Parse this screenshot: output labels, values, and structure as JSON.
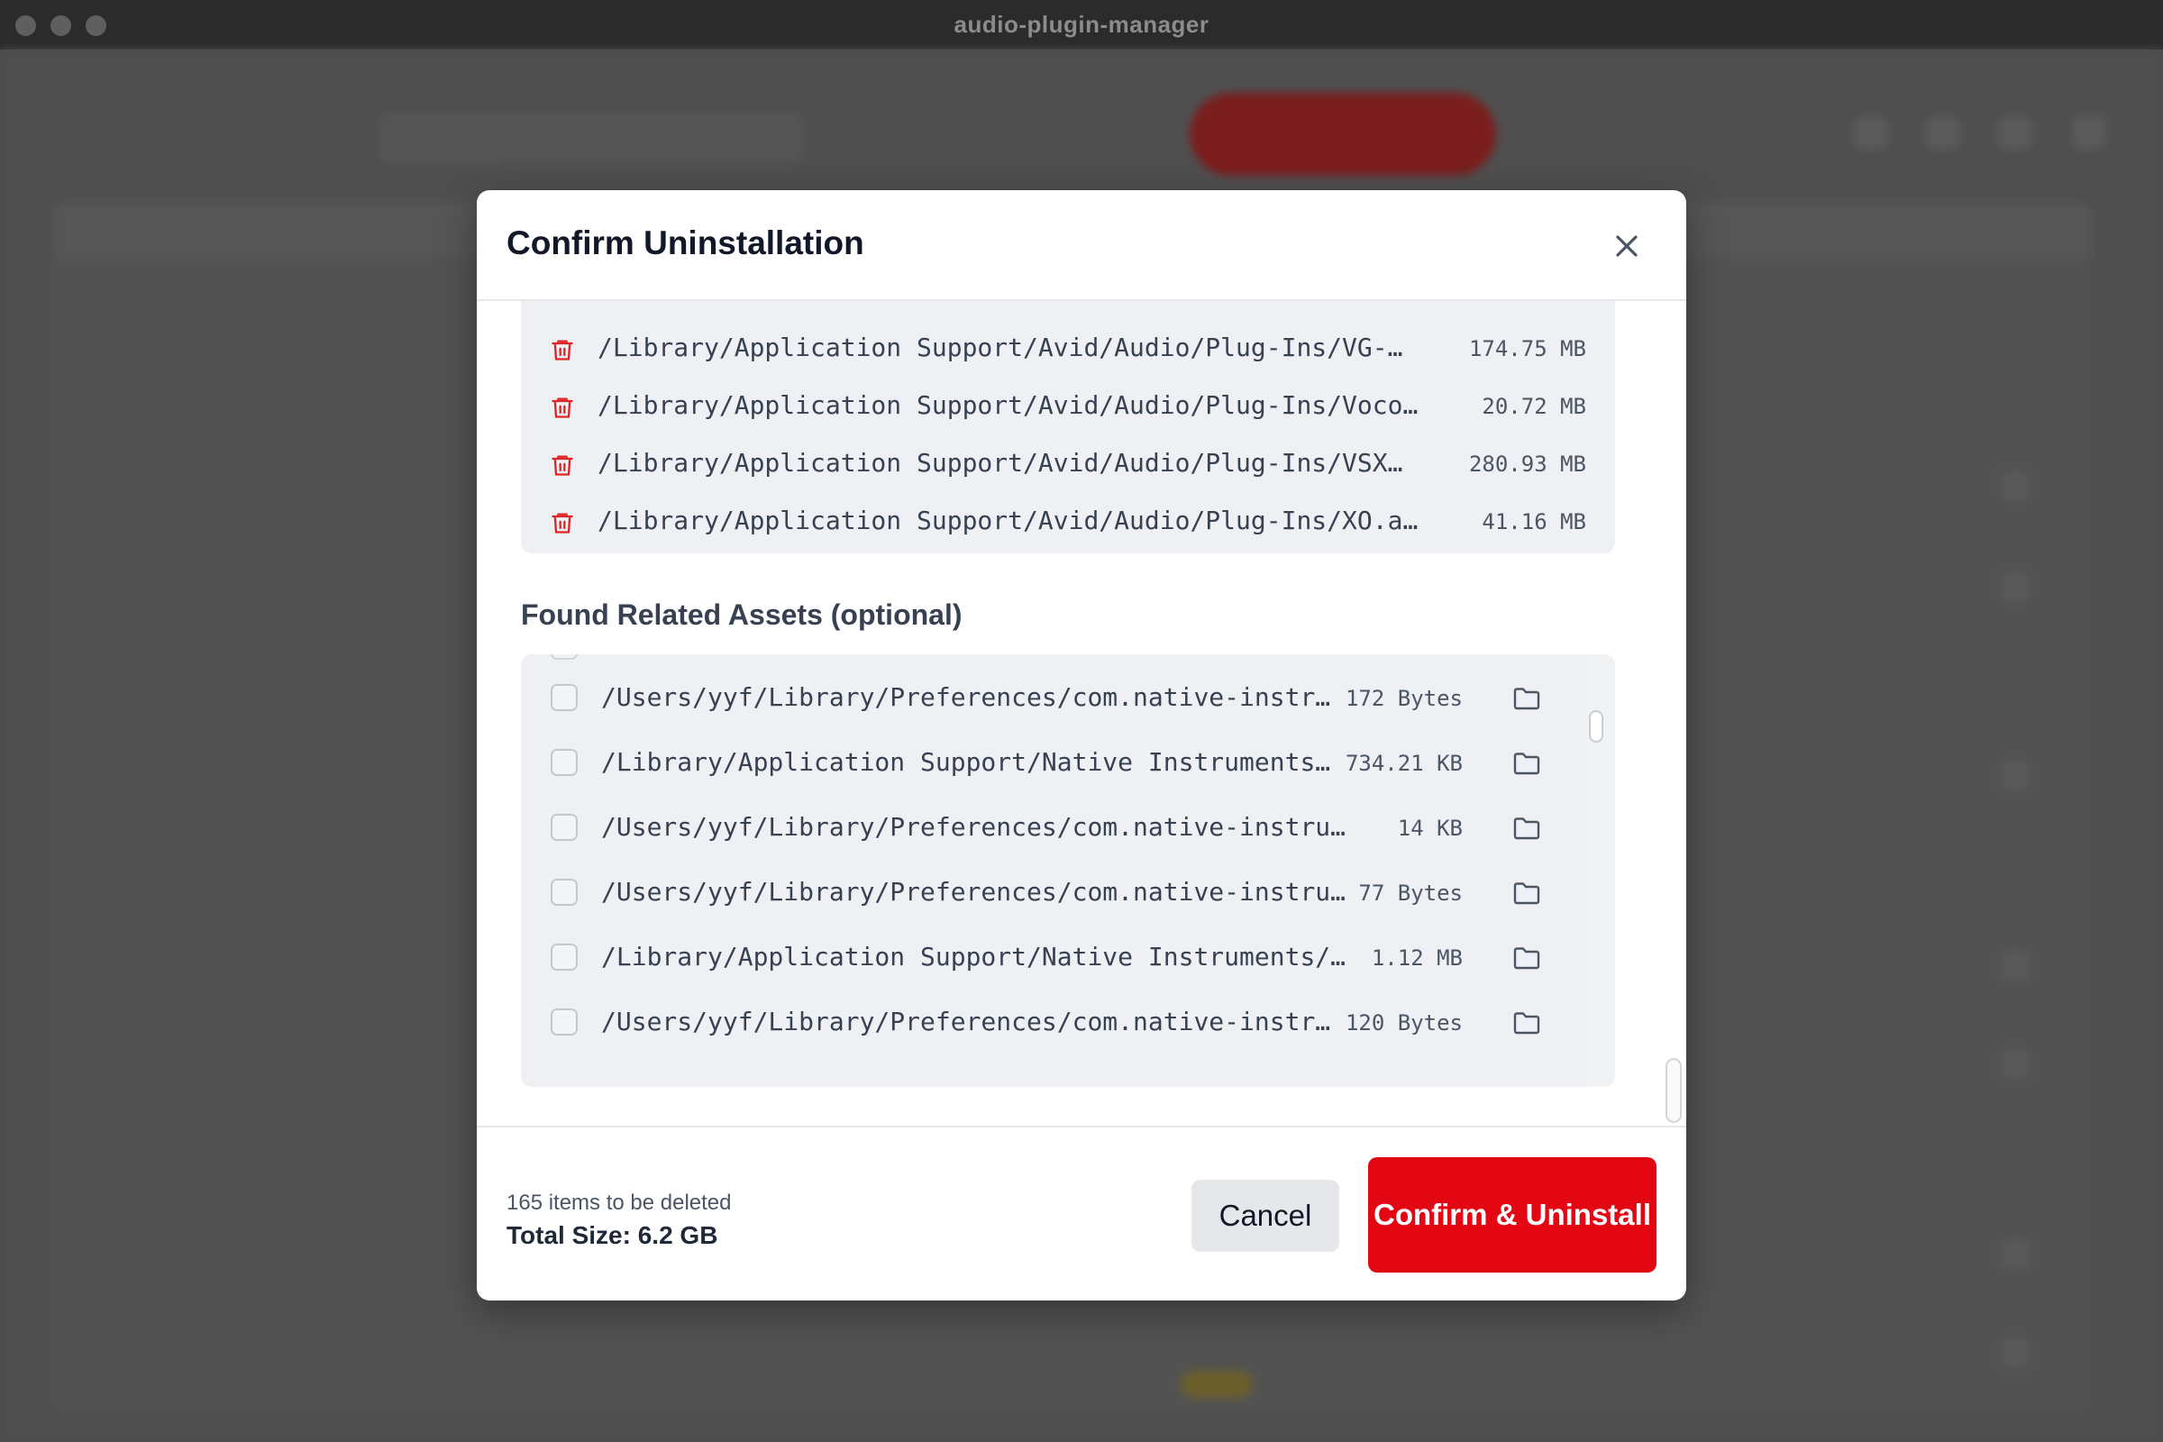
{
  "window": {
    "title": "audio-plugin-manager"
  },
  "modal": {
    "title": "Confirm Uninstallation",
    "files": [
      {
        "path": "/Library/Application Support/Avid/Audio/Plug-Ins/VG-…",
        "size": "174.75 MB"
      },
      {
        "path": "/Library/Application Support/Avid/Audio/Plug-Ins/Voco…",
        "size": "20.72 MB"
      },
      {
        "path": "/Library/Application Support/Avid/Audio/Plug-Ins/VSX…",
        "size": "280.93 MB"
      },
      {
        "path": "/Library/Application Support/Avid/Audio/Plug-Ins/XO.a…",
        "size": "41.16 MB"
      }
    ],
    "related_heading": "Found Related Assets (optional)",
    "assets": [
      {
        "path": "/Users/yyf/Library/Preferences/com.native-instr…",
        "size": "172 Bytes",
        "checked": false
      },
      {
        "path": "/Library/Application Support/Native Instruments…",
        "size": "734.21 KB",
        "checked": false
      },
      {
        "path": "/Users/yyf/Library/Preferences/com.native-instrume…",
        "size": "14 KB",
        "checked": false
      },
      {
        "path": "/Users/yyf/Library/Preferences/com.native-instru…",
        "size": "77 Bytes",
        "checked": false
      },
      {
        "path": "/Library/Application Support/Native Instruments/…",
        "size": "1.12 MB",
        "checked": false
      },
      {
        "path": "/Users/yyf/Library/Preferences/com.native-instr…",
        "size": "120 Bytes",
        "checked": false
      }
    ],
    "footer": {
      "items_count": "165 items to be deleted",
      "total_size": "Total Size: 6.2 GB",
      "cancel_label": "Cancel",
      "confirm_label": "Confirm & Uninstall"
    }
  },
  "icons": {
    "close": "close-icon",
    "trash": "trash-icon",
    "folder": "folder-icon",
    "checkbox": "checkbox-unchecked"
  },
  "colors": {
    "danger": "#e30613",
    "trash_icon": "#dc2626",
    "list_background": "#eef0f4",
    "overlay": "#4d4d4d"
  }
}
